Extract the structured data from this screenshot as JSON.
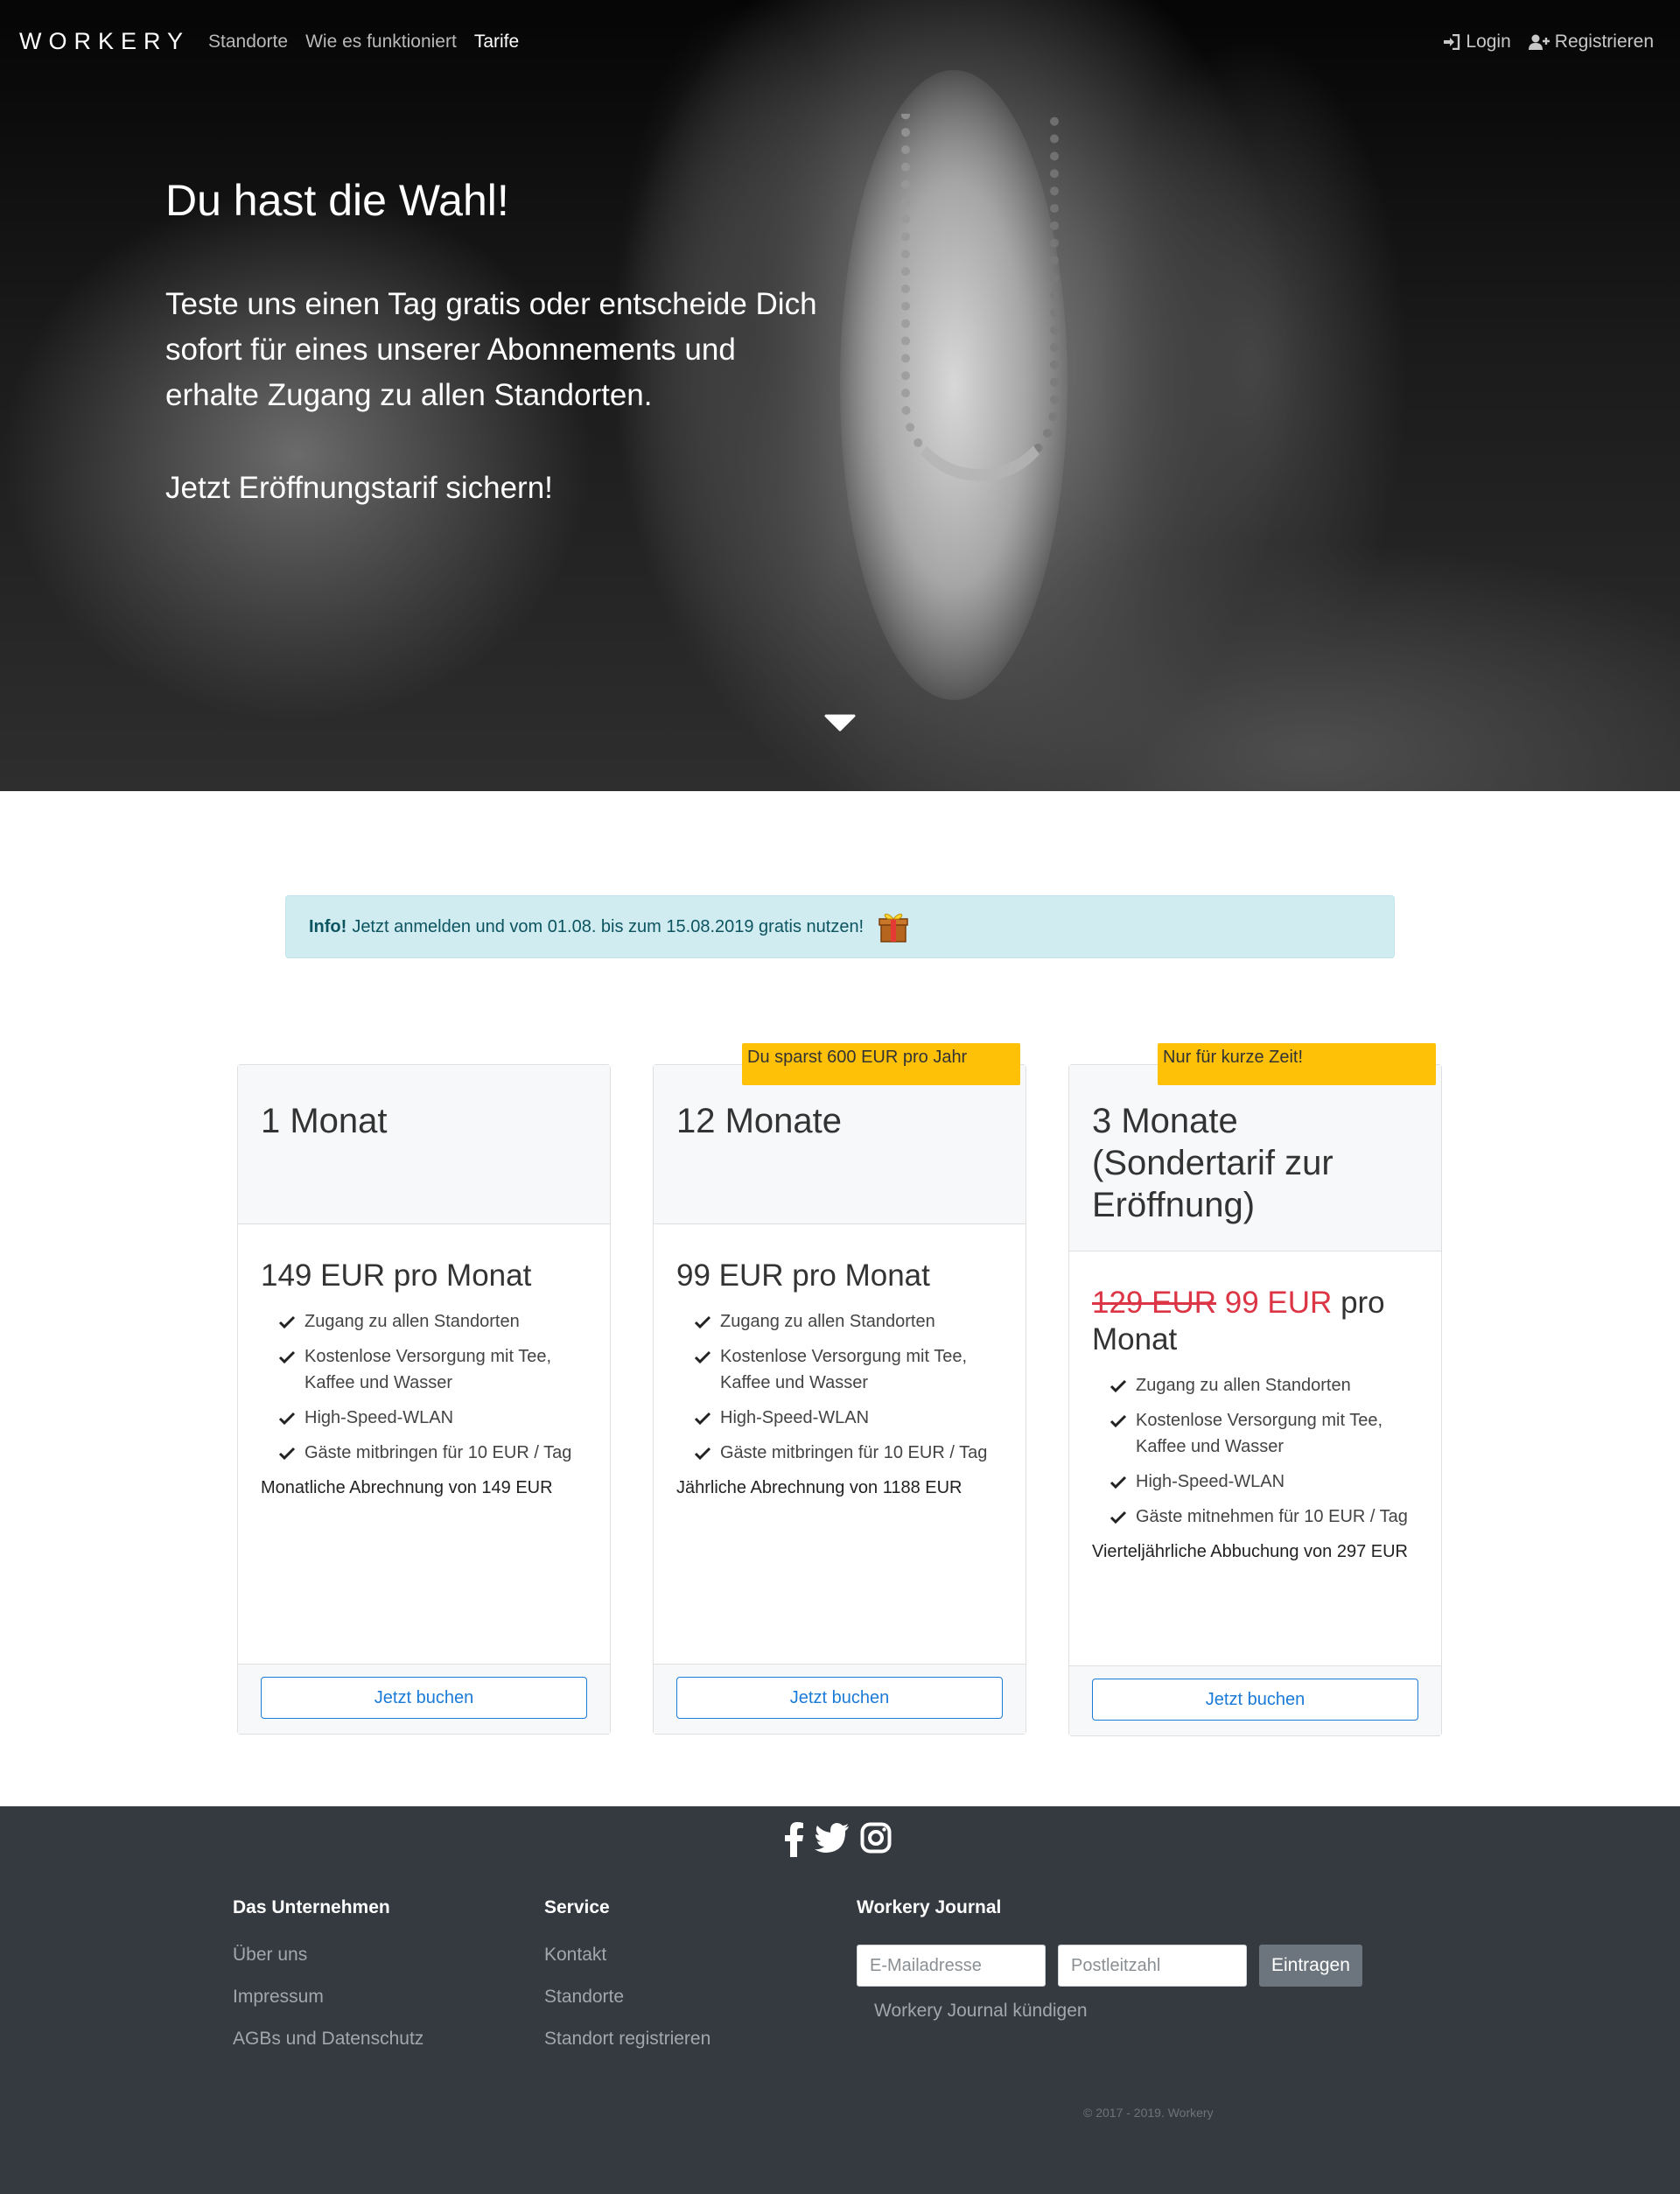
{
  "nav": {
    "logo": "WORKERY",
    "links": [
      "Standorte",
      "Wie es funktioniert",
      "Tarife"
    ],
    "login": "Login",
    "register": "Registrieren"
  },
  "hero": {
    "title": "Du hast die Wahl!",
    "text": "Teste uns einen Tag gratis oder entscheide Dich sofort für eines unserer Abonnements und erhalte Zugang zu allen Standorten.",
    "cta": "Jetzt Eröffnungstarif sichern!"
  },
  "alert": {
    "strong": "Info!",
    "text": "Jetzt anmelden und vom 01.08. bis zum 15.08.2019 gratis nutzen!"
  },
  "plans": [
    {
      "title": "1 Monat",
      "price": "149 EUR pro Monat",
      "features": [
        "Zugang zu allen Standorten",
        "Kostenlose Versorgung mit Tee, Kaffee und Wasser",
        "High-Speed-WLAN",
        "Gäste mitbringen für 10 EUR / Tag"
      ],
      "billing": "Monatliche Abrechnung von 149 EUR",
      "button": "Jetzt buchen"
    },
    {
      "ribbon": "Du sparst 600 EUR pro Jahr",
      "title": "12 Monate",
      "price": "99 EUR pro Monat",
      "features": [
        "Zugang zu allen Standorten",
        "Kostenlose Versorgung mit Tee, Kaffee und Wasser",
        "High-Speed-WLAN",
        "Gäste mitbringen für 10 EUR / Tag"
      ],
      "billing": "Jährliche Abrechnung von 1188 EUR",
      "button": "Jetzt buchen"
    },
    {
      "ribbon": "Nur für kurze Zeit!",
      "title": "3 Monate (Sondertarif zur Eröffnung)",
      "price_old": "129 EUR",
      "price_new": "99 EUR",
      "price_suffix": "pro Monat",
      "features": [
        "Zugang zu allen Standorten",
        "Kostenlose Versorgung mit Tee, Kaffee und Wasser",
        "High-Speed-WLAN",
        "Gäste mitnehmen für 10 EUR / Tag"
      ],
      "billing": "Vierteljährliche Abbuchung von 297 EUR",
      "button": "Jetzt buchen"
    }
  ],
  "footer": {
    "social": [
      "facebook-icon",
      "twitter-icon",
      "instagram-icon"
    ],
    "company": {
      "title": "Das Unternehmen",
      "links": [
        "Über uns",
        "Impressum",
        "AGBs und Datenschutz"
      ]
    },
    "service": {
      "title": "Service",
      "links": [
        "Kontakt",
        "Standorte",
        "Standort registrieren"
      ]
    },
    "journal": {
      "title": "Workery Journal",
      "email_placeholder": "E-Mailadresse",
      "zip_placeholder": "Postleitzahl",
      "submit": "Eintragen",
      "unsubscribe": "Workery Journal kündigen"
    },
    "copyright": "© 2017 - 2019. Workery"
  },
  "colors": {
    "accent": "#1a7bd8",
    "ribbon": "#ffc107",
    "price_highlight": "#dc3545",
    "footer_bg": "#343a40",
    "alert_bg": "#d1ecf1"
  }
}
